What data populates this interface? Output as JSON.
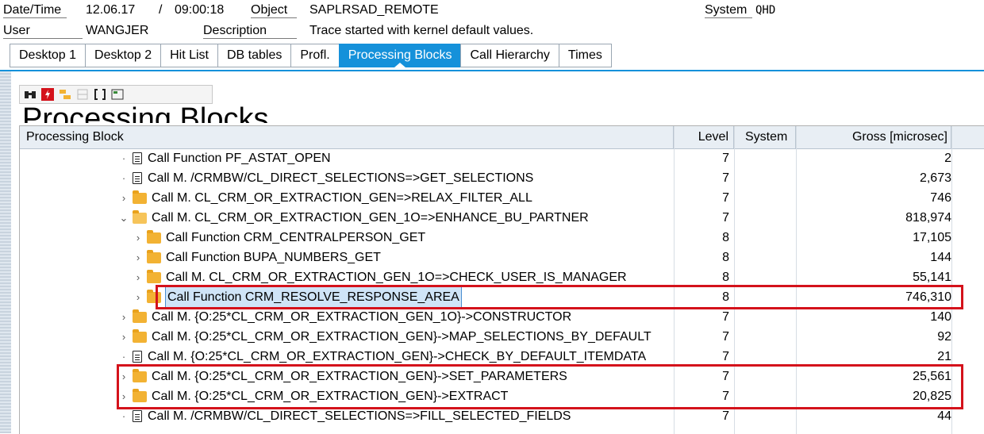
{
  "header": {
    "datetime_label": "Date/Time",
    "date": "12.06.17",
    "sep": "/",
    "time": "09:00:18",
    "object_label": "Object",
    "object_value": "SAPLRSAD_REMOTE",
    "system_label": "System",
    "system_value": "QHD",
    "user_label": "User",
    "user_value": "WANGJER",
    "description_label": "Description",
    "description_value": "Trace started with kernel default values."
  },
  "tabs": [
    "Desktop 1",
    "Desktop 2",
    "Hit List",
    "DB tables",
    "Profl.",
    "Processing Blocks",
    "Call Hierarchy",
    "Times"
  ],
  "active_tab": "Processing Blocks",
  "page_title": "Processing Blocks",
  "columns": {
    "block": "Processing Block",
    "level": "Level",
    "system": "System",
    "gross": "Gross [microsec]"
  },
  "rows": [
    {
      "expander": "·",
      "icon": "doc",
      "label": "Call Function PF_ASTAT_OPEN",
      "level": "7",
      "gross": "2",
      "indent": 0
    },
    {
      "expander": "·",
      "icon": "doc",
      "label": "Call M. /CRMBW/CL_DIRECT_SELECTIONS=>GET_SELECTIONS",
      "level": "7",
      "gross": "2,673",
      "indent": 0
    },
    {
      "expander": "›",
      "icon": "folder",
      "label": "Call M. CL_CRM_OR_EXTRACTION_GEN=>RELAX_FILTER_ALL",
      "level": "7",
      "gross": "746",
      "indent": 0
    },
    {
      "expander": "⌄",
      "icon": "folder-open",
      "label": "Call M. CL_CRM_OR_EXTRACTION_GEN_1O=>ENHANCE_BU_PARTNER",
      "level": "7",
      "gross": "818,974",
      "indent": 0
    },
    {
      "expander": "›",
      "icon": "folder",
      "label": "Call Function CRM_CENTRALPERSON_GET",
      "level": "8",
      "gross": "17,105",
      "indent": 1
    },
    {
      "expander": "›",
      "icon": "folder",
      "label": "Call Function BUPA_NUMBERS_GET",
      "level": "8",
      "gross": "144",
      "indent": 1
    },
    {
      "expander": "›",
      "icon": "folder",
      "label": "Call M. CL_CRM_OR_EXTRACTION_GEN_1O=>CHECK_USER_IS_MANAGER",
      "level": "8",
      "gross": "55,141",
      "indent": 1
    },
    {
      "expander": "›",
      "icon": "folder",
      "label": "Call Function CRM_RESOLVE_RESPONSE_AREA",
      "level": "8",
      "gross": "746,310",
      "indent": 1,
      "selected": true
    },
    {
      "expander": "›",
      "icon": "folder",
      "label": "Call M. {O:25*CL_CRM_OR_EXTRACTION_GEN_1O}->CONSTRUCTOR",
      "level": "7",
      "gross": "140",
      "indent": 0
    },
    {
      "expander": "›",
      "icon": "folder",
      "label": "Call M. {O:25*CL_CRM_OR_EXTRACTION_GEN}->MAP_SELECTIONS_BY_DEFAULT",
      "level": "7",
      "gross": "92",
      "indent": 0
    },
    {
      "expander": "·",
      "icon": "doc",
      "label": "Call M. {O:25*CL_CRM_OR_EXTRACTION_GEN}->CHECK_BY_DEFAULT_ITEMDATA",
      "level": "7",
      "gross": "21",
      "indent": 0
    },
    {
      "expander": "›",
      "icon": "folder",
      "label": "Call M. {O:25*CL_CRM_OR_EXTRACTION_GEN}->SET_PARAMETERS",
      "level": "7",
      "gross": "25,561",
      "indent": 0
    },
    {
      "expander": "›",
      "icon": "folder",
      "label": "Call M. {O:25*CL_CRM_OR_EXTRACTION_GEN}->EXTRACT",
      "level": "7",
      "gross": "20,825",
      "indent": 0
    },
    {
      "expander": "·",
      "icon": "doc",
      "label": "Call M. /CRMBW/CL_DIRECT_SELECTIONS=>FILL_SELECTED_FIELDS",
      "level": "7",
      "gross": "44",
      "indent": 0
    }
  ],
  "colors": {
    "accent": "#1591da",
    "highlight": "#d4121b",
    "folder": "#f2b233"
  }
}
